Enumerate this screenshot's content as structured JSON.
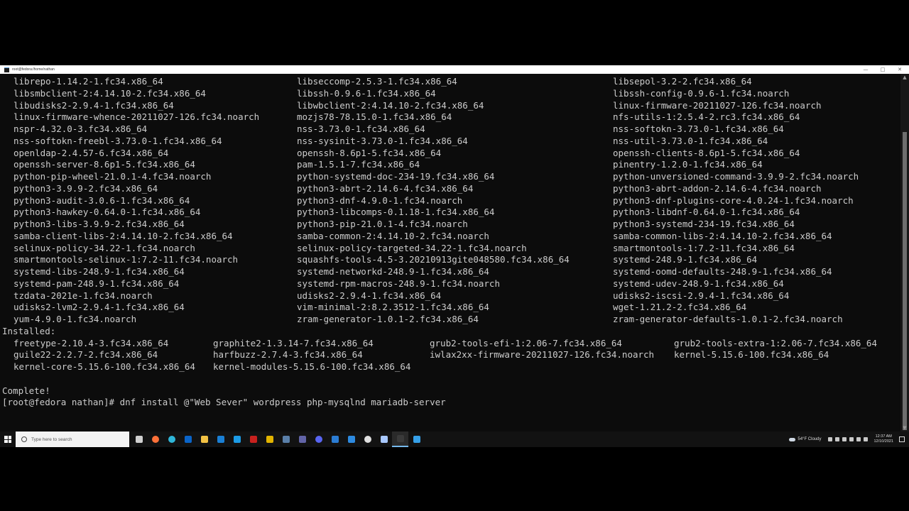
{
  "window": {
    "title": "root@fedora:/home/nathan",
    "controls": {
      "minimize": "—",
      "maximize": "□",
      "close": "✕"
    }
  },
  "terminal": {
    "grid3": [
      [
        "librepo-1.14.2-1.fc34.x86_64",
        "libseccomp-2.5.3-1.fc34.x86_64",
        "libsepol-3.2-2.fc34.x86_64"
      ],
      [
        "libsmbclient-2:4.14.10-2.fc34.x86_64",
        "libssh-0.9.6-1.fc34.x86_64",
        "libssh-config-0.9.6-1.fc34.noarch"
      ],
      [
        "libudisks2-2.9.4-1.fc34.x86_64",
        "libwbclient-2:4.14.10-2.fc34.x86_64",
        "linux-firmware-20211027-126.fc34.noarch"
      ],
      [
        "linux-firmware-whence-20211027-126.fc34.noarch",
        "mozjs78-78.15.0-1.fc34.x86_64",
        "nfs-utils-1:2.5.4-2.rc3.fc34.x86_64"
      ],
      [
        "nspr-4.32.0-3.fc34.x86_64",
        "nss-3.73.0-1.fc34.x86_64",
        "nss-softokn-3.73.0-1.fc34.x86_64"
      ],
      [
        "nss-softokn-freebl-3.73.0-1.fc34.x86_64",
        "nss-sysinit-3.73.0-1.fc34.x86_64",
        "nss-util-3.73.0-1.fc34.x86_64"
      ],
      [
        "openldap-2.4.57-6.fc34.x86_64",
        "openssh-8.6p1-5.fc34.x86_64",
        "openssh-clients-8.6p1-5.fc34.x86_64"
      ],
      [
        "openssh-server-8.6p1-5.fc34.x86_64",
        "pam-1.5.1-7.fc34.x86_64",
        "pinentry-1.2.0-1.fc34.x86_64"
      ],
      [
        "python-pip-wheel-21.0.1-4.fc34.noarch",
        "python-systemd-doc-234-19.fc34.x86_64",
        "python-unversioned-command-3.9.9-2.fc34.noarch"
      ],
      [
        "python3-3.9.9-2.fc34.x86_64",
        "python3-abrt-2.14.6-4.fc34.x86_64",
        "python3-abrt-addon-2.14.6-4.fc34.noarch"
      ],
      [
        "python3-audit-3.0.6-1.fc34.x86_64",
        "python3-dnf-4.9.0-1.fc34.noarch",
        "python3-dnf-plugins-core-4.0.24-1.fc34.noarch"
      ],
      [
        "python3-hawkey-0.64.0-1.fc34.x86_64",
        "python3-libcomps-0.1.18-1.fc34.x86_64",
        "python3-libdnf-0.64.0-1.fc34.x86_64"
      ],
      [
        "python3-libs-3.9.9-2.fc34.x86_64",
        "python3-pip-21.0.1-4.fc34.noarch",
        "python3-systemd-234-19.fc34.x86_64"
      ],
      [
        "samba-client-libs-2:4.14.10-2.fc34.x86_64",
        "samba-common-2:4.14.10-2.fc34.noarch",
        "samba-common-libs-2:4.14.10-2.fc34.x86_64"
      ],
      [
        "selinux-policy-34.22-1.fc34.noarch",
        "selinux-policy-targeted-34.22-1.fc34.noarch",
        "smartmontools-1:7.2-11.fc34.x86_64"
      ],
      [
        "smartmontools-selinux-1:7.2-11.fc34.noarch",
        "squashfs-tools-4.5-3.20210913gite048580.fc34.x86_64",
        "systemd-248.9-1.fc34.x86_64"
      ],
      [
        "systemd-libs-248.9-1.fc34.x86_64",
        "systemd-networkd-248.9-1.fc34.x86_64",
        "systemd-oomd-defaults-248.9-1.fc34.x86_64"
      ],
      [
        "systemd-pam-248.9-1.fc34.x86_64",
        "systemd-rpm-macros-248.9-1.fc34.noarch",
        "systemd-udev-248.9-1.fc34.x86_64"
      ],
      [
        "tzdata-2021e-1.fc34.noarch",
        "udisks2-2.9.4-1.fc34.x86_64",
        "udisks2-iscsi-2.9.4-1.fc34.x86_64"
      ],
      [
        "udisks2-lvm2-2.9.4-1.fc34.x86_64",
        "vim-minimal-2:8.2.3512-1.fc34.x86_64",
        "wget-1.21.2-2.fc34.x86_64"
      ],
      [
        "yum-4.9.0-1.fc34.noarch",
        "zram-generator-1.0.1-2.fc34.x86_64",
        "zram-generator-defaults-1.0.1-2.fc34.noarch"
      ]
    ],
    "installed_header": "Installed:",
    "grid4": [
      [
        "freetype-2.10.4-3.fc34.x86_64",
        "graphite2-1.3.14-7.fc34.x86_64",
        "grub2-tools-efi-1:2.06-7.fc34.x86_64",
        "grub2-tools-extra-1:2.06-7.fc34.x86_64"
      ],
      [
        "guile22-2.2.7-2.fc34.x86_64",
        "harfbuzz-2.7.4-3.fc34.x86_64",
        "iwlax2xx-firmware-20211027-126.fc34.noarch",
        "kernel-5.15.6-100.fc34.x86_64"
      ],
      [
        "kernel-core-5.15.6-100.fc34.x86_64",
        "kernel-modules-5.15.6-100.fc34.x86_64",
        "",
        ""
      ]
    ],
    "complete": "Complete!",
    "prompt": "[root@fedora nathan]# ",
    "command": "dnf install @\"Web Sever\" wordpress php-mysqlnd mariadb-server"
  },
  "taskbar": {
    "search_placeholder": "Type here to search",
    "apps": [
      {
        "name": "task-view-icon",
        "color": "#d0d0d0"
      },
      {
        "name": "firefox-icon",
        "color": "#ff7139"
      },
      {
        "name": "edge-icon",
        "color": "#2fb6d9"
      },
      {
        "name": "outlook-icon",
        "color": "#0a64c8"
      },
      {
        "name": "file-explorer-icon",
        "color": "#f3c244"
      },
      {
        "name": "mail-icon",
        "color": "#1a7fd4"
      },
      {
        "name": "store-icon",
        "color": "#1c9be6"
      },
      {
        "name": "filezilla-icon",
        "color": "#c8211e"
      },
      {
        "name": "norton-icon",
        "color": "#e2b400"
      },
      {
        "name": "steam-icon",
        "color": "#5a7fa8"
      },
      {
        "name": "teams-icon",
        "color": "#6264a7"
      },
      {
        "name": "discord-icon",
        "color": "#5865f2"
      },
      {
        "name": "document-icon",
        "color": "#2b7cd3"
      },
      {
        "name": "remote-desktop-icon",
        "color": "#2d8ae0"
      },
      {
        "name": "chrome-icon",
        "color": "#e0e0e0"
      },
      {
        "name": "virtualbox-icon",
        "color": "#a8c8ff"
      },
      {
        "name": "terminal-icon",
        "color": "#3a3a3a"
      },
      {
        "name": "snipping-tool-icon",
        "color": "#36a0e8"
      }
    ],
    "active_app_index": 16,
    "weather": "54°F  Cloudy",
    "time": "12:37 AM",
    "date": "12/10/2021"
  }
}
